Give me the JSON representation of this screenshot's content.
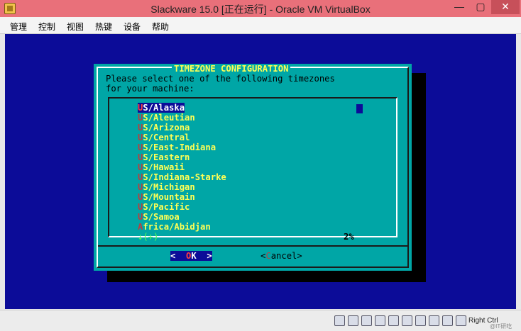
{
  "window": {
    "title": "Slackware 15.0 [正在运行] - Oracle VM VirtualBox",
    "minimize": "—",
    "maximize": "▢",
    "close": "✕"
  },
  "menu": {
    "items": [
      "管理",
      "控制",
      "视图",
      "热键",
      "设备",
      "帮助"
    ]
  },
  "dialog": {
    "title": "TIMEZONE CONFIGURATION",
    "prompt_line1": "Please select one of the following timezones",
    "prompt_line2": "for your machine:",
    "scroll_indicator": "↓(+)",
    "scroll_percent": "2%",
    "ok_left": "<  ",
    "ok_hotkey": "O",
    "ok_rest": "K  >",
    "cancel_left": "<",
    "cancel_hotkey": "C",
    "cancel_rest": "ancel>"
  },
  "timezones": {
    "selected_index": 0,
    "items": [
      {
        "hotkey": "U",
        "rest": "S/Alaska"
      },
      {
        "hotkey": "U",
        "rest": "S/Aleutian"
      },
      {
        "hotkey": "U",
        "rest": "S/Arizona"
      },
      {
        "hotkey": "U",
        "rest": "S/Central"
      },
      {
        "hotkey": "U",
        "rest": "S/East-Indiana"
      },
      {
        "hotkey": "U",
        "rest": "S/Eastern"
      },
      {
        "hotkey": "U",
        "rest": "S/Hawaii"
      },
      {
        "hotkey": "U",
        "rest": "S/Indiana-Starke"
      },
      {
        "hotkey": "U",
        "rest": "S/Michigan"
      },
      {
        "hotkey": "U",
        "rest": "S/Mountain"
      },
      {
        "hotkey": "U",
        "rest": "S/Pacific"
      },
      {
        "hotkey": "U",
        "rest": "S/Samoa"
      },
      {
        "hotkey": "A",
        "rest": "frica/Abidjan"
      }
    ]
  },
  "statusbar": {
    "host_key": "Right Ctrl",
    "icons": [
      "hard-disk-icon",
      "optical-drive-icon",
      "usb-icon",
      "network-icon",
      "shared-folder-icon",
      "display-icon",
      "recording-icon",
      "cpu-icon",
      "mouse-integration-icon",
      "keyboard-icon"
    ],
    "watermark": "@IT研吃"
  },
  "colors": {
    "vm_background": "#0c0c98",
    "dialog_background": "#00a6a6",
    "list_text": "#ffff55",
    "titlebar": "#e9707a"
  }
}
